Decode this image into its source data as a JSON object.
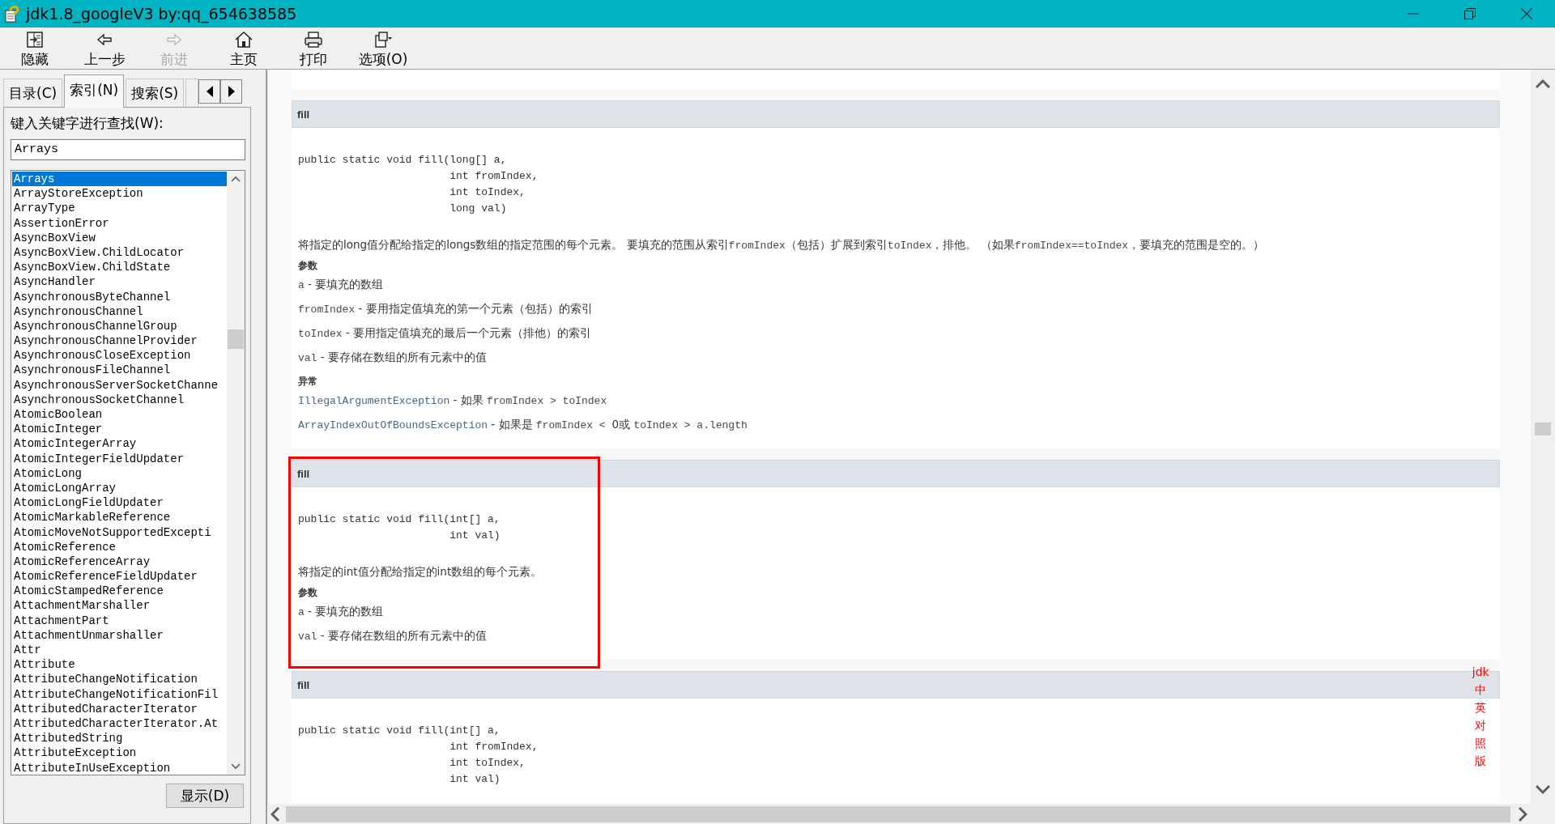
{
  "window": {
    "title": "jdk1.8_googleV3 by:qq_654638585"
  },
  "toolbar": [
    {
      "label": "隐藏",
      "disabled": false
    },
    {
      "label": "上一步",
      "disabled": false
    },
    {
      "label": "前进",
      "disabled": true
    },
    {
      "label": "主页",
      "disabled": false
    },
    {
      "label": "打印",
      "disabled": false
    },
    {
      "label": "选项(O)",
      "disabled": false
    }
  ],
  "nav": {
    "tabs": [
      {
        "label": "目录(C)",
        "selected": false
      },
      {
        "label": "索引(N)",
        "selected": true
      },
      {
        "label": "搜索(S)",
        "selected": false
      }
    ],
    "keyword_label": "键入关键字进行查找(W):",
    "keyword": "Arrays",
    "items": [
      {
        "label": "Arrays",
        "selected": true
      },
      {
        "label": "ArrayStoreException",
        "selected": false
      },
      {
        "label": "ArrayType",
        "selected": false
      },
      {
        "label": "AssertionError",
        "selected": false
      },
      {
        "label": "AsyncBoxView",
        "selected": false
      },
      {
        "label": "AsyncBoxView.ChildLocator",
        "selected": false
      },
      {
        "label": "AsyncBoxView.ChildState",
        "selected": false
      },
      {
        "label": "AsyncHandler",
        "selected": false
      },
      {
        "label": "AsynchronousByteChannel",
        "selected": false
      },
      {
        "label": "AsynchronousChannel",
        "selected": false
      },
      {
        "label": "AsynchronousChannelGroup",
        "selected": false
      },
      {
        "label": "AsynchronousChannelProvider",
        "selected": false
      },
      {
        "label": "AsynchronousCloseException",
        "selected": false
      },
      {
        "label": "AsynchronousFileChannel",
        "selected": false
      },
      {
        "label": "AsynchronousServerSocketChanne",
        "selected": false
      },
      {
        "label": "AsynchronousSocketChannel",
        "selected": false
      },
      {
        "label": "AtomicBoolean",
        "selected": false
      },
      {
        "label": "AtomicInteger",
        "selected": false
      },
      {
        "label": "AtomicIntegerArray",
        "selected": false
      },
      {
        "label": "AtomicIntegerFieldUpdater",
        "selected": false
      },
      {
        "label": "AtomicLong",
        "selected": false
      },
      {
        "label": "AtomicLongArray",
        "selected": false
      },
      {
        "label": "AtomicLongFieldUpdater",
        "selected": false
      },
      {
        "label": "AtomicMarkableReference",
        "selected": false
      },
      {
        "label": "AtomicMoveNotSupportedExcepti",
        "selected": false
      },
      {
        "label": "AtomicReference",
        "selected": false
      },
      {
        "label": "AtomicReferenceArray",
        "selected": false
      },
      {
        "label": "AtomicReferenceFieldUpdater",
        "selected": false
      },
      {
        "label": "AtomicStampedReference",
        "selected": false
      },
      {
        "label": "AttachmentMarshaller",
        "selected": false
      },
      {
        "label": "AttachmentPart",
        "selected": false
      },
      {
        "label": "AttachmentUnmarshaller",
        "selected": false
      },
      {
        "label": "Attr",
        "selected": false
      },
      {
        "label": "Attribute",
        "selected": false
      },
      {
        "label": "AttributeChangeNotification",
        "selected": false
      },
      {
        "label": "AttributeChangeNotificationFil",
        "selected": false
      },
      {
        "label": "AttributedCharacterIterator",
        "selected": false
      },
      {
        "label": "AttributedCharacterIterator.At",
        "selected": false
      },
      {
        "label": "AttributedString",
        "selected": false
      },
      {
        "label": "AttributeException",
        "selected": false
      },
      {
        "label": "AttributeInUseException",
        "selected": false
      }
    ],
    "display_button": "显示(D)"
  },
  "document": {
    "side_note": "jdk中英对照版",
    "methods": [
      {
        "name": "fill",
        "highlighted": false,
        "signature": [
          "public static void fill(long[] a,",
          "int fromIndex,",
          "int toIndex,",
          "long val)"
        ],
        "description": [
          {
            "kind": "text",
            "text": "将指定的long值分配给指定的longs数组的指定范围的每个元素。 要填充的范围从索引"
          },
          {
            "kind": "code",
            "text": "fromIndex"
          },
          {
            "kind": "text",
            "text": "（包括）扩展到索引"
          },
          {
            "kind": "code",
            "text": "toIndex"
          },
          {
            "kind": "text",
            "text": "，排他。 （如果"
          },
          {
            "kind": "code",
            "text": "fromIndex==toIndex"
          },
          {
            "kind": "text",
            "text": "，要填充的范围是空的。）"
          }
        ],
        "params_heading": "参数",
        "params": [
          {
            "name": "a",
            "text": "- 要填充的数组"
          },
          {
            "name": "fromIndex",
            "text": "- 要用指定值填充的第一个元素（包括）的索引"
          },
          {
            "name": "toIndex",
            "text": "- 要用指定值填充的最后一个元素（排他）的索引"
          },
          {
            "name": "val",
            "text": "- 要存储在数组的所有元素中的值"
          }
        ],
        "throws_heading": "异常",
        "throws": [
          {
            "name": "IllegalArgumentException",
            "text": [
              {
                "kind": "text",
                "text": "- 如果 "
              },
              {
                "kind": "code",
                "text": "fromIndex > toIndex"
              }
            ]
          },
          {
            "name": "ArrayIndexOutOfBoundsException",
            "text": [
              {
                "kind": "text",
                "text": "- 如果是 "
              },
              {
                "kind": "code",
                "text": "fromIndex < "
              },
              {
                "kind": "text",
                "text": "0或 "
              },
              {
                "kind": "code",
                "text": "toIndex > a.length"
              }
            ]
          }
        ]
      },
      {
        "name": "fill",
        "highlighted": true,
        "signature": [
          "public static void fill(int[] a,",
          "int val)"
        ],
        "description": [
          {
            "kind": "text",
            "text": "将指定的int值分配给指定的int数组的每个元素。"
          }
        ],
        "params_heading": "参数",
        "params": [
          {
            "name": "a",
            "text": "- 要填充的数组"
          },
          {
            "name": "val",
            "text": "- 要存储在数组的所有元素中的值"
          }
        ]
      },
      {
        "name": "fill",
        "highlighted": false,
        "signature": [
          "public static void fill(int[] a,",
          "int fromIndex,",
          "int toIndex,",
          "int val)"
        ]
      }
    ]
  }
}
